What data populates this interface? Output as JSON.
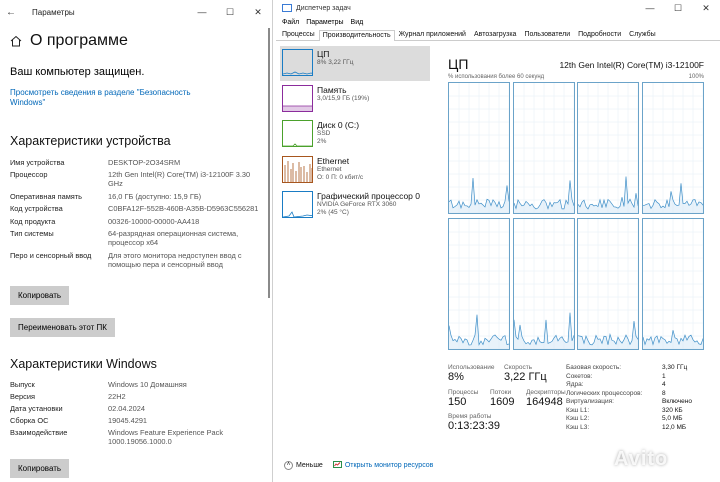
{
  "settings": {
    "window_title": "Параметры",
    "page_title": "О программе",
    "protected_text": "Ваш компьютер защищен.",
    "security_link": "Просмотреть сведения в разделе \"Безопасность Windows\"",
    "device_spec_heading": "Характеристики устройства",
    "device_specs": [
      {
        "k": "Имя устройства",
        "v": "DESKTOP-2O34SRM"
      },
      {
        "k": "Процессор",
        "v": "12th Gen Intel(R) Core(TM) i3-12100F   3.30 GHz"
      },
      {
        "k": "Оперативная память",
        "v": "16,0 ГБ (доступно: 15,9 ГБ)"
      },
      {
        "k": "Код устройства",
        "v": "C0BFA12F-552B-460B-A35B-D5963C556281"
      },
      {
        "k": "Код продукта",
        "v": "00326-10000-00000-AA418"
      },
      {
        "k": "Тип системы",
        "v": "64-разрядная операционная система, процессор x64"
      },
      {
        "k": "Перо и сенсорный ввод",
        "v": "Для этого монитора недоступен ввод с помощью пера и сенсорный ввод"
      }
    ],
    "copy_button_1": "Копировать",
    "rename_button": "Переименовать этот ПК",
    "windows_spec_heading": "Характеристики Windows",
    "windows_specs": [
      {
        "k": "Выпуск",
        "v": "Windows 10 Домашняя"
      },
      {
        "k": "Версия",
        "v": "22H2"
      },
      {
        "k": "Дата установки",
        "v": "02.04.2024"
      },
      {
        "k": "Сборка ОС",
        "v": "19045.4291"
      },
      {
        "k": "Взаимодействие",
        "v": "Windows Feature Experience Pack 1000.19056.1000.0"
      }
    ],
    "copy_button_2": "Копировать"
  },
  "taskmgr": {
    "window_title": "Диспетчер задач",
    "menu": [
      "Файл",
      "Параметры",
      "Вид"
    ],
    "tabs": [
      "Процессы",
      "Производительность",
      "Журнал приложений",
      "Автозагрузка",
      "Пользователи",
      "Подробности",
      "Службы"
    ],
    "active_tab": "Производительность",
    "resources": [
      {
        "name": "ЦП",
        "line1": "8% 3,22 ГГц",
        "line2": "",
        "color": "#1a7cc4"
      },
      {
        "name": "Память",
        "line1": "3,0/15,9 ГБ (19%)",
        "line2": "",
        "color": "#8b2c9c"
      },
      {
        "name": "Диск 0 (C:)",
        "line1": "SSD",
        "line2": "2%",
        "color": "#4ba12c"
      },
      {
        "name": "Ethernet",
        "line1": "Ethernet",
        "line2": "О: 0 П: 0 кбит/с",
        "color": "#a7561e"
      },
      {
        "name": "Графический процессор 0",
        "line1": "NVIDIA GeForce RTX 3060",
        "line2": "2% (45 °C)",
        "color": "#1a7cc4"
      }
    ],
    "cpu_title": "ЦП",
    "cpu_model": "12th Gen Intel(R) Core(TM) i3-12100F",
    "cpu_graph_caption": "% использования более 60 секунд",
    "cpu_graph_max": "100%",
    "stats": {
      "usage_label": "Использование",
      "usage": "8%",
      "speed_label": "Скорость",
      "speed": "3,22 ГГц",
      "processes_label": "Процессы",
      "processes": "150",
      "threads_label": "Потоки",
      "threads": "1609",
      "handles_label": "Дескрипторы",
      "handles": "164948",
      "uptime_label": "Время работы",
      "uptime": "0:13:23:39"
    },
    "details": [
      {
        "k": "Базовая скорость:",
        "v": "3,30 ГГц"
      },
      {
        "k": "Сокетов:",
        "v": "1"
      },
      {
        "k": "Ядра:",
        "v": "4"
      },
      {
        "k": "Логических процессоров:",
        "v": "8"
      },
      {
        "k": "Виртуализация:",
        "v": "Включено"
      },
      {
        "k": "Кэш L1:",
        "v": "320 КБ"
      },
      {
        "k": "Кэш L2:",
        "v": "5,0 МБ"
      },
      {
        "k": "Кэш L3:",
        "v": "12,0 МБ"
      }
    ],
    "less_label": "Меньше",
    "resource_monitor_link": "Открыть монитор ресурсов"
  },
  "watermark": "Avito"
}
